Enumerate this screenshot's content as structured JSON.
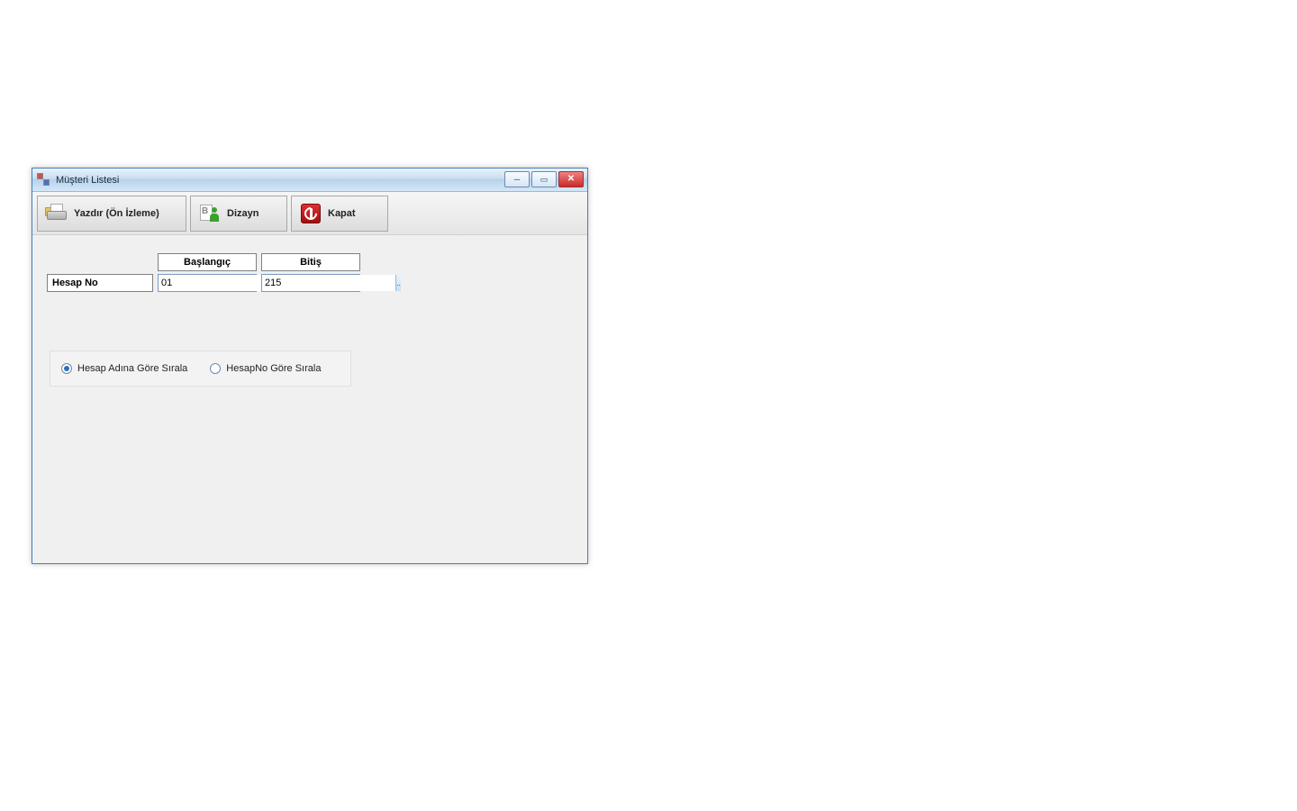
{
  "window": {
    "title": "Müşteri Listesi"
  },
  "toolbar": {
    "print_label": "Yazdır (Ön İzleme)",
    "design_label": "Dizayn",
    "close_label": "Kapat"
  },
  "filters": {
    "row_label": "Hesap No",
    "start_header": "Başlangıç",
    "end_header": "Bitiş",
    "start_value": "01",
    "end_value": "215",
    "lookup_label": ".."
  },
  "sort": {
    "by_name_label": "Hesap Adına Göre Sırala",
    "by_no_label": "HesapNo Göre Sırala",
    "selected": "by_name"
  }
}
